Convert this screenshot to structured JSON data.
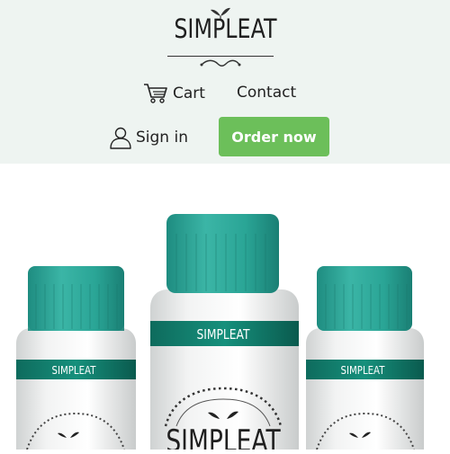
{
  "brand": {
    "name": "SIMPLEAT"
  },
  "nav": {
    "cart_label": "Cart",
    "contact_label": "Contact",
    "signin_label": "Sign in",
    "order_label": "Order now"
  },
  "hero": {
    "bottle_labels": [
      "SIMPLEAT",
      "SIMPLEAT",
      "SIMPLEAT"
    ],
    "front_logo": "SIMPLEAT"
  },
  "colors": {
    "header_bg": "#eef4f1",
    "accent_green": "#6cbf5a",
    "cap_teal": "#2aa596",
    "label_teal": "#0f7e6c"
  }
}
